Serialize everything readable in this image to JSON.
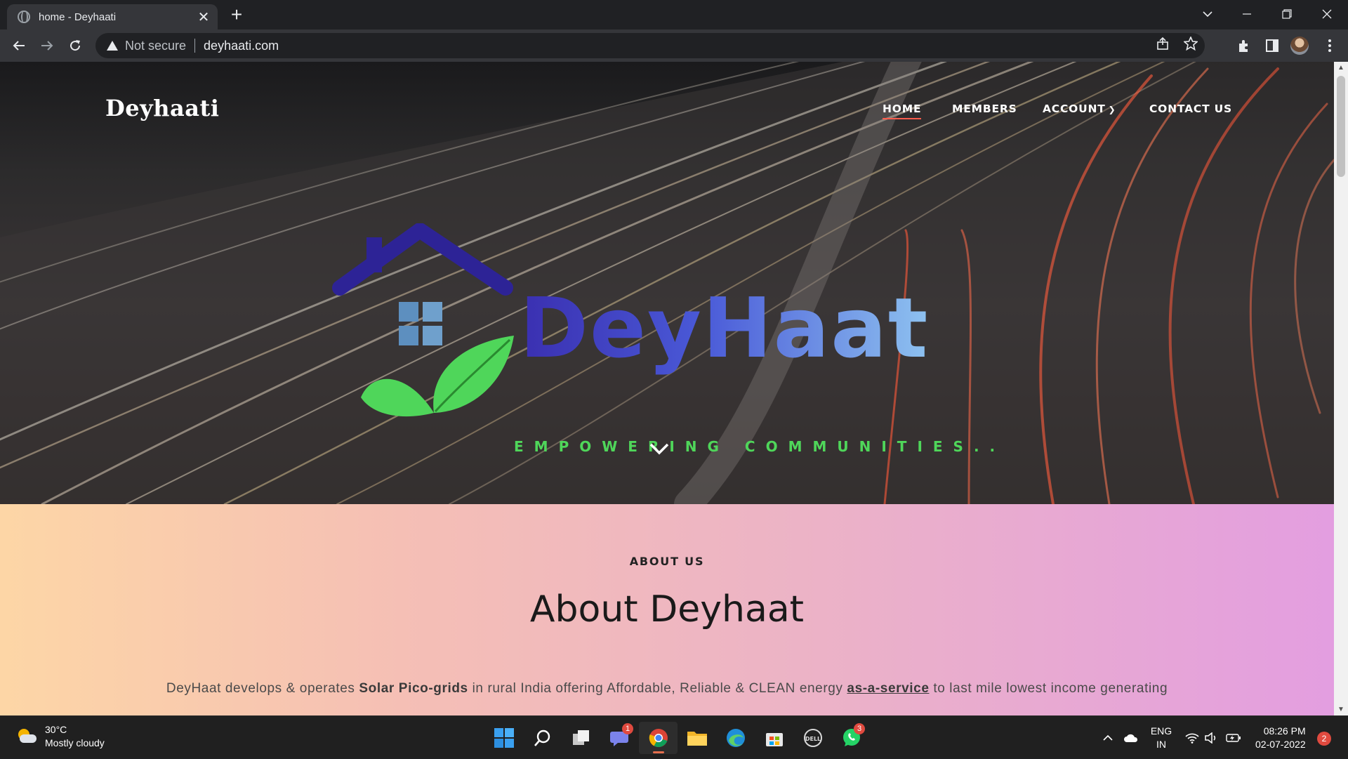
{
  "browser": {
    "tab_title": "home - Deyhaati",
    "tab_close": "✕",
    "new_tab": "+",
    "security_label": "Not secure",
    "url": "deyhaati.com",
    "icons": [
      "back-icon",
      "forward-icon",
      "reload-icon",
      "warning-icon",
      "share-icon",
      "star-icon",
      "extensions-icon",
      "side-panel-icon",
      "profile-avatar",
      "menu-icon"
    ]
  },
  "site": {
    "logo": "Deyhaati",
    "nav": {
      "home": "HOME",
      "members": "MEMBERS",
      "account": "ACCOUNT",
      "contact": "CONTACT US"
    },
    "hero": {
      "brand_word": "DeyHaat",
      "tagline": "EMPOWERING COMMUNITIES.."
    },
    "about": {
      "label": "ABOUT US",
      "title": "About Deyhaat",
      "text_1": "DeyHaat develops & operates ",
      "text_bold": "Solar Pico-grids",
      "text_2": "  in rural India offering Affordable, Reliable & CLEAN energy ",
      "text_link": "as-a-service",
      "text_3": " to last mile lowest income generating"
    }
  },
  "taskbar": {
    "weather_temp": "30°C",
    "weather_desc": "Mostly cloudy",
    "chat_badge": "1",
    "whatsapp_badge": "3",
    "lang_1": "ENG",
    "lang_2": "IN",
    "time": "08:26 PM",
    "date": "02-07-2022",
    "notifications": "2"
  },
  "colors": {
    "accent_underline": "#ff5d4d",
    "brand_blue": "#3a2fb0",
    "brand_green": "#4fd65a"
  }
}
